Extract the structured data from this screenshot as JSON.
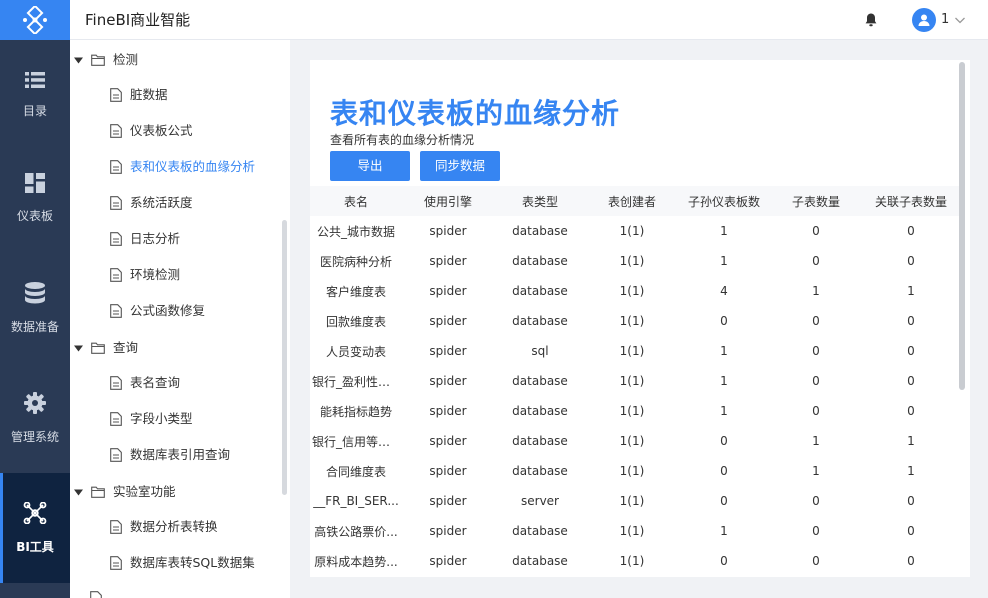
{
  "header": {
    "app_title": "FineBI商业智能",
    "user_name": "1"
  },
  "colors": {
    "accent": "#3685f2",
    "nav_bg": "#2a3a55",
    "nav_active_bg": "#0f2340"
  },
  "leftnav": {
    "items": [
      {
        "label": "目录",
        "icon": "list-icon"
      },
      {
        "label": "仪表板",
        "icon": "dashboard-icon"
      },
      {
        "label": "数据准备",
        "icon": "database-icon"
      },
      {
        "label": "管理系统",
        "icon": "gear-icon"
      },
      {
        "label": "BI工具",
        "icon": "network-icon",
        "active": true
      }
    ]
  },
  "tree": {
    "groups": [
      {
        "label": "检测",
        "items": [
          "脏数据",
          "仪表板公式",
          "表和仪表板的血缘分析",
          "系统活跃度",
          "日志分析",
          "环境检测",
          "公式函数修复"
        ]
      },
      {
        "label": "查询",
        "items": [
          "表名查询",
          "字段小类型",
          "数据库表引用查询"
        ]
      },
      {
        "label": "实验室功能",
        "items": [
          "数据分析表转换",
          "数据库表转SQL数据集"
        ]
      }
    ],
    "active_item": "表和仪表板的血缘分析"
  },
  "main": {
    "title": "表和仪表板的血缘分析",
    "description": "查看所有表的血缘分析情况",
    "buttons": {
      "export": "导出",
      "sync": "同步数据"
    },
    "table": {
      "columns": [
        "表名",
        "使用引擎",
        "表类型",
        "表创建者",
        "子孙仪表板数",
        "子表数量",
        "关联子表数量"
      ],
      "rows": [
        [
          "公共_城市数据",
          "spider",
          "database",
          "1(1)",
          "1",
          "0",
          "0"
        ],
        [
          "医院病种分析",
          "spider",
          "database",
          "1(1)",
          "1",
          "0",
          "0"
        ],
        [
          "客户维度表",
          "spider",
          "database",
          "1(1)",
          "4",
          "1",
          "1"
        ],
        [
          "回款维度表",
          "spider",
          "database",
          "1(1)",
          "0",
          "0",
          "0"
        ],
        [
          "人员变动表",
          "spider",
          "sql",
          "1(1)",
          "1",
          "0",
          "0"
        ],
        [
          "银行_盈利性分...",
          "spider",
          "database",
          "1(1)",
          "1",
          "0",
          "0"
        ],
        [
          "能耗指标趋势",
          "spider",
          "database",
          "1(1)",
          "1",
          "0",
          "0"
        ],
        [
          "银行_信用等级...",
          "spider",
          "database",
          "1(1)",
          "0",
          "1",
          "1"
        ],
        [
          "合同维度表",
          "spider",
          "database",
          "1(1)",
          "0",
          "1",
          "1"
        ],
        [
          "__FR_BI_SER...",
          "spider",
          "server",
          "1(1)",
          "0",
          "0",
          "0"
        ],
        [
          "高铁公路票价...",
          "spider",
          "database",
          "1(1)",
          "1",
          "0",
          "0"
        ],
        [
          "原料成本趋势...",
          "spider",
          "database",
          "1(1)",
          "0",
          "0",
          "0"
        ]
      ]
    }
  }
}
